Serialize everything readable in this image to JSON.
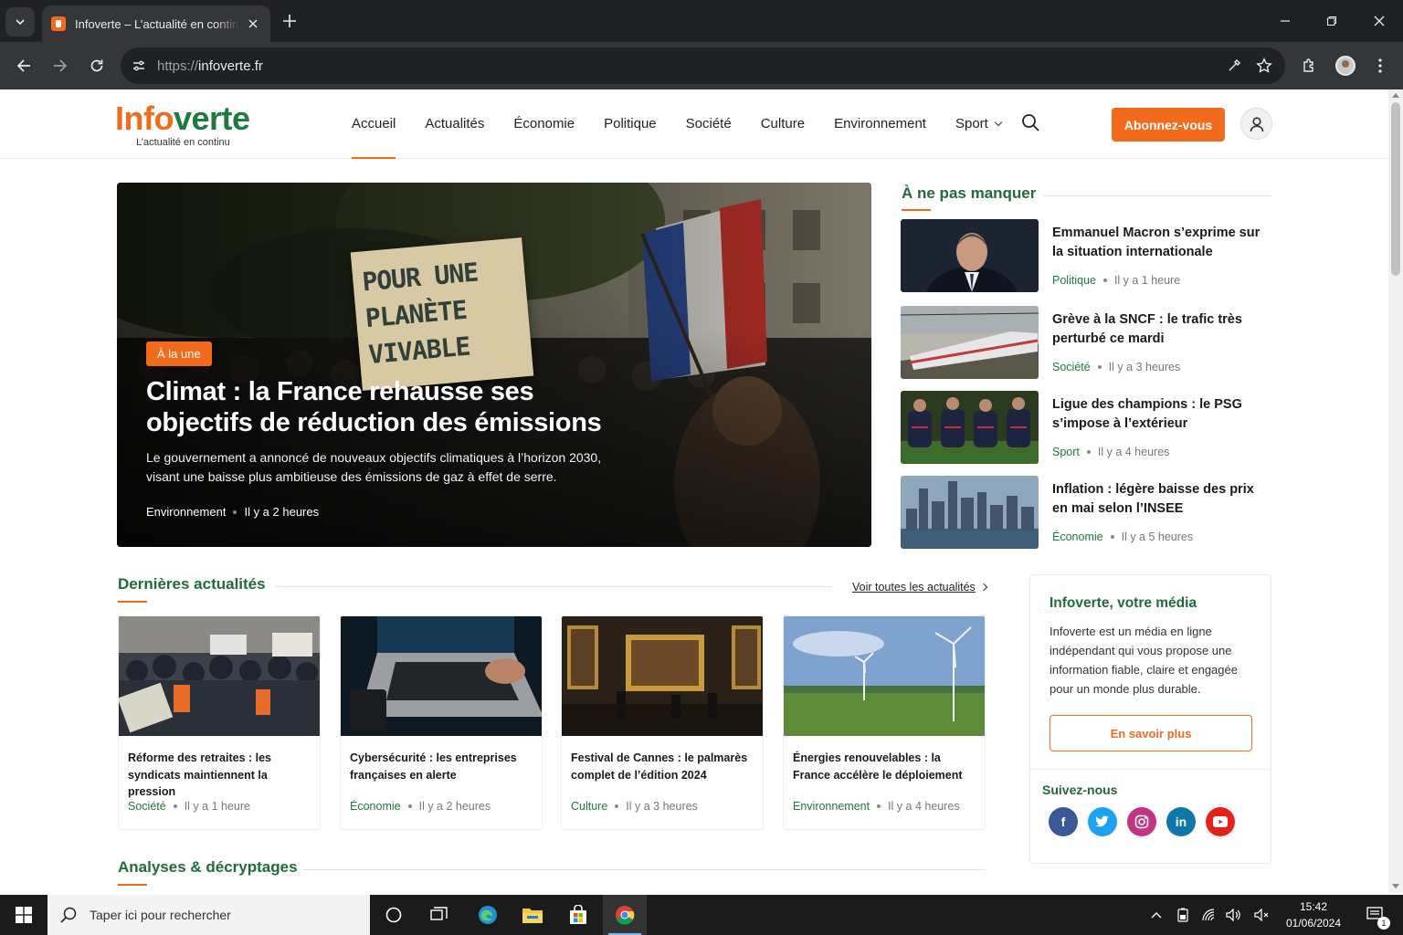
{
  "browser": {
    "tab_title": "Infoverte – L’actualité en continu",
    "url_scheme": "https://",
    "url_host": "infoverte.fr"
  },
  "site": {
    "logo_a": "Info",
    "logo_b": "verte",
    "tagline": "L’actualité en continu",
    "nav": [
      "Accueil",
      "Actualités",
      "Économie",
      "Politique",
      "Société",
      "Culture",
      "Environnement",
      "Sport"
    ],
    "active_nav": "Accueil",
    "subscribe_label": "Abonnez-vous"
  },
  "hero": {
    "badge": "À la une",
    "title": "Climat : la France rehausse ses objectifs de réduction des émissions",
    "description": "Le gouvernement a annoncé de nouveaux objectifs climatiques à l’horizon 2030, visant une baisse plus ambitieuse des émissions de gaz à effet de serre.",
    "category": "Environnement",
    "time": "Il y a 2 heures",
    "sign_lines": [
      "POUR UNE",
      "PLANÈTE",
      "VIVABLE"
    ]
  },
  "must_read": {
    "title": "À ne pas manquer",
    "items": [
      {
        "title": "Emmanuel Macron s’exprime sur la situation internationale",
        "category": "Politique",
        "time": "Il y a 1 heure"
      },
      {
        "title": "Grève à la SNCF : le trafic très perturbé ce mardi",
        "category": "Société",
        "time": "Il y a 3 heures"
      },
      {
        "title": "Ligue des champions : le PSG s’impose à l’extérieur",
        "category": "Sport",
        "time": "Il y a 4 heures"
      },
      {
        "title": "Inflation : légère baisse des prix en mai selon l’INSEE",
        "category": "Économie",
        "time": "Il y a 5 heures"
      }
    ]
  },
  "latest": {
    "title": "Dernières actualités",
    "see_all": "Voir toutes les actualités",
    "cards": [
      {
        "title": "Réforme des retraites : les syndicats maintiennent la pression",
        "category": "Société",
        "time": "Il y a 1 heure"
      },
      {
        "title": "Cybersécurité : les entreprises françaises en alerte",
        "category": "Économie",
        "time": "Il y a 2 heures"
      },
      {
        "title": "Festival de Cannes : le palmarès complet de l’édition 2024",
        "category": "Culture",
        "time": "Il y a 3 heures"
      },
      {
        "title": "Énergies renouvelables : la France accélère le déploiement",
        "category": "Environnement",
        "time": "Il y a 4 heures"
      }
    ]
  },
  "about": {
    "title": "Infoverte, votre média",
    "text": "Infoverte est un média en ligne indépendant qui vous propose une information fiable, claire et engagée pour un monde plus durable.",
    "button": "En savoir plus",
    "follow_title": "Suivez-nous",
    "socials": [
      {
        "name": "facebook",
        "glyph": "f",
        "color": "#3b5998"
      },
      {
        "name": "twitter",
        "glyph": "t",
        "color": "#1da1f2"
      },
      {
        "name": "instagram",
        "glyph": "◎",
        "color": "#c13584"
      },
      {
        "name": "linkedin",
        "glyph": "in",
        "color": "#0e76a8"
      },
      {
        "name": "youtube",
        "glyph": "▶",
        "color": "#e62117"
      }
    ]
  },
  "analyses": {
    "title": "Analyses & décryptages"
  },
  "taskbar": {
    "search_placeholder": "Taper ici pour rechercher",
    "time": "15:42",
    "date": "01/06/2024",
    "notif_count": "1"
  },
  "colors": {
    "brand_orange": "#f26b1d",
    "brand_green": "#1f7a3d"
  }
}
